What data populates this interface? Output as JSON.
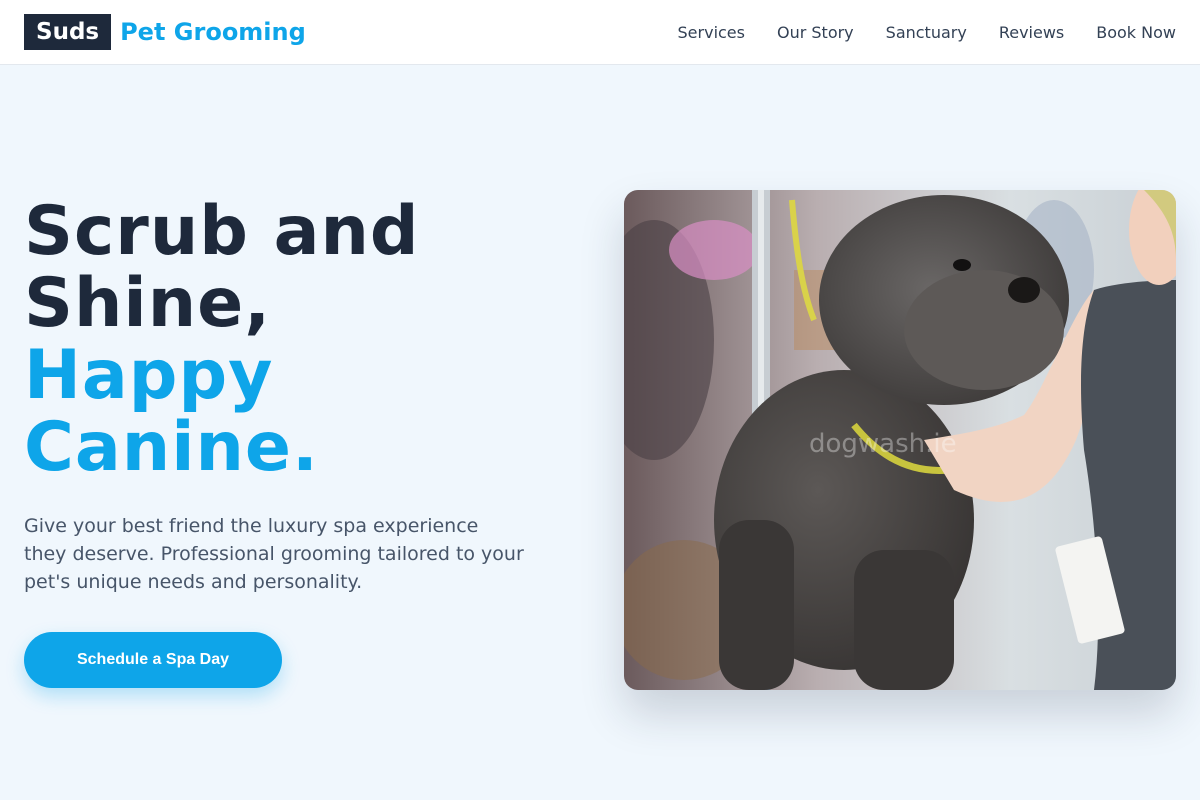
{
  "brand": {
    "box_text": "Suds",
    "name": "Pet Grooming"
  },
  "nav": {
    "links": [
      "Services",
      "Our Story",
      "Sanctuary",
      "Reviews",
      "Book Now"
    ]
  },
  "hero": {
    "headline_lines": [
      "Scrub and",
      "Shine,"
    ],
    "headline_accent_lines": [
      "Happy",
      "Canine."
    ],
    "subtext": "Give your best friend the luxury spa experience they deserve. Professional grooming tailored to your pet's unique needs and personality.",
    "cta_label": "Schedule a Spa Day"
  },
  "photo": {
    "watermark": "dogwash.ie",
    "alt": "Groomer holding a grey poodle on a grooming table"
  },
  "colors": {
    "accent": "#0ea5e9",
    "dark": "#1e293b",
    "background": "#f0f7fd"
  }
}
